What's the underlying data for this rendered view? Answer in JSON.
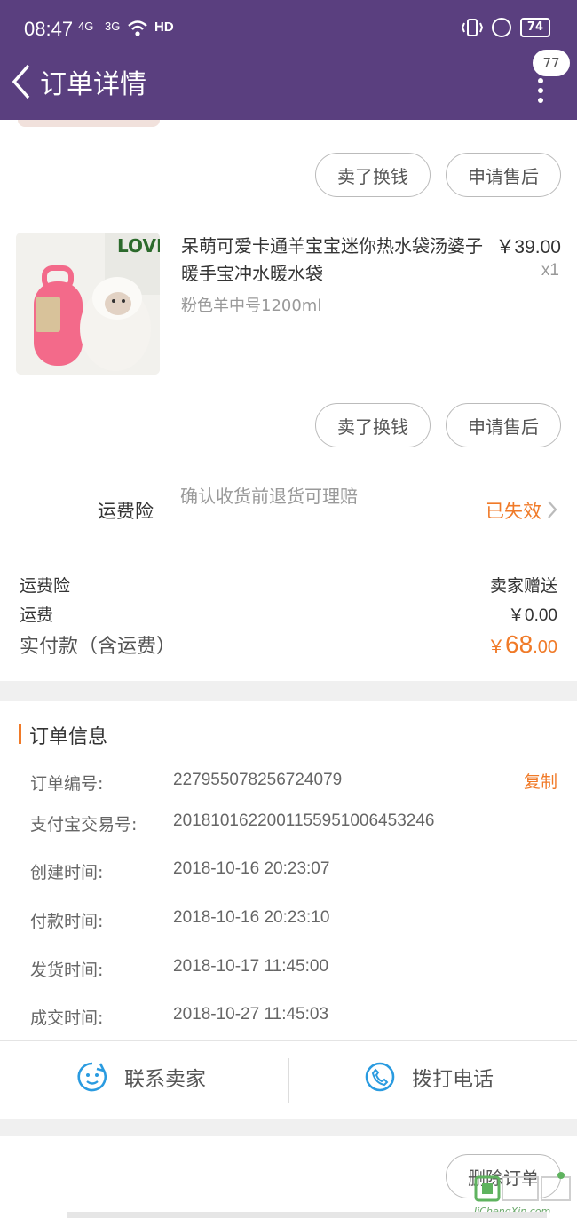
{
  "status_bar": {
    "time": "08:47",
    "sig1": "4G",
    "sig2": "3G",
    "hd": "HD",
    "battery": "74"
  },
  "header": {
    "title": "订单详情",
    "badge_count": "77"
  },
  "buttons": {
    "sell": "卖了换钱",
    "after_sale": "申请售后",
    "delete_order": "删除订单"
  },
  "product": {
    "name": "呆萌可爱卡通羊宝宝迷你热水袋汤婆子暖手宝冲水暖水袋",
    "sku": "粉色羊中号1200ml",
    "price": "￥39.00",
    "qty": "x1",
    "image_text": "LOVE"
  },
  "insurance": {
    "label": "运费险",
    "desc": "确认收货前退货可理赔",
    "status": "已失效"
  },
  "fees": {
    "insurance_label": "运费险",
    "insurance_value": "卖家赠送",
    "shipping_label": "运费",
    "shipping_value": "￥0.00",
    "total_label": "实付款（含运费）",
    "total_currency": "￥",
    "total_int": "68",
    "total_dec": ".00"
  },
  "order_info": {
    "title": "订单信息",
    "copy": "复制",
    "rows": [
      {
        "label": "订单编号:",
        "value": "227955078256724079"
      },
      {
        "label": "支付宝交易号:",
        "value": "2018101622001155951006453246"
      },
      {
        "label": "创建时间:",
        "value": "2018-10-16 20:23:07"
      },
      {
        "label": "付款时间:",
        "value": "2018-10-16 20:23:10"
      },
      {
        "label": "发货时间:",
        "value": "2018-10-17 11:45:00"
      },
      {
        "label": "成交时间:",
        "value": "2018-10-27 11:45:03"
      }
    ]
  },
  "actions": {
    "contact_seller": "联系卖家",
    "call": "拨打电话"
  },
  "watermark": {
    "text": "JiChengXin.com"
  },
  "colors": {
    "header_bg": "#5a3f7f",
    "accent_orange": "#f07a28",
    "icon_blue": "#2a9be0"
  }
}
